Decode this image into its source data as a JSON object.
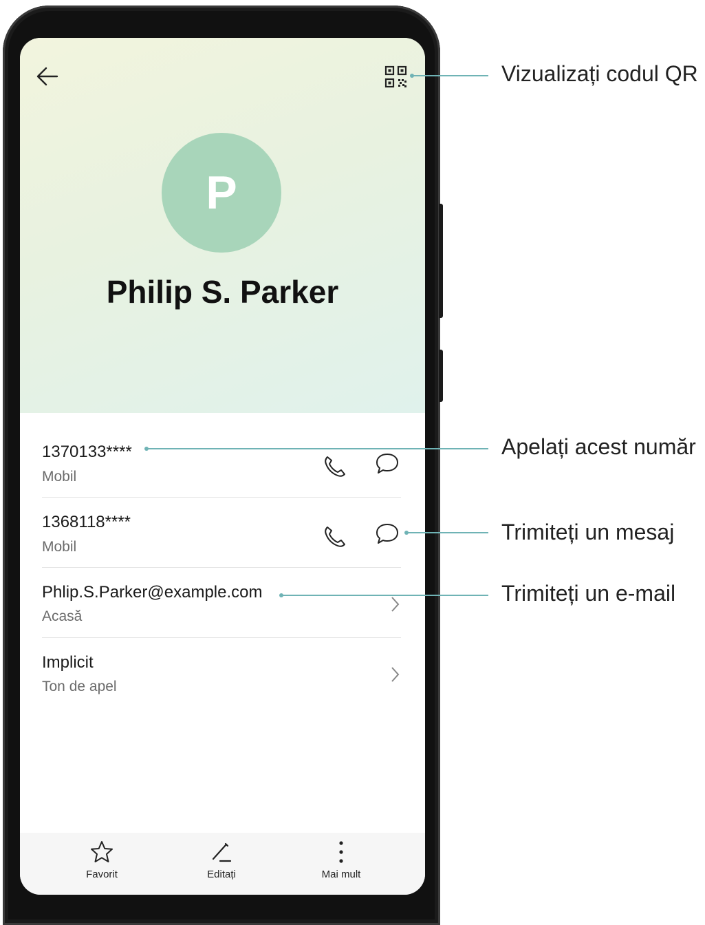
{
  "contact": {
    "avatar_letter": "P",
    "name": "Philip S. Parker",
    "avatar_color": "#a8d5ba"
  },
  "header": {
    "back_icon": "arrow-left-icon",
    "qr_icon": "qr-code-icon"
  },
  "rows": [
    {
      "primary": "1370133****",
      "secondary": "Mobil"
    },
    {
      "primary": "1368118****",
      "secondary": "Mobil"
    },
    {
      "primary": "Phlip.S.Parker@example.com",
      "secondary": "Acasă"
    },
    {
      "primary": "Implicit",
      "secondary": "Ton de apel"
    }
  ],
  "bottom_bar": {
    "favorite": "Favorit",
    "edit": "Editați",
    "more": "Mai mult"
  },
  "callouts": {
    "qr": "Vizualizați codul QR",
    "call": "Apelați acest număr",
    "message": "Trimiteți un mesaj",
    "email": "Trimiteți un e-mail"
  },
  "colors": {
    "accent_line": "#6fb3b5"
  }
}
